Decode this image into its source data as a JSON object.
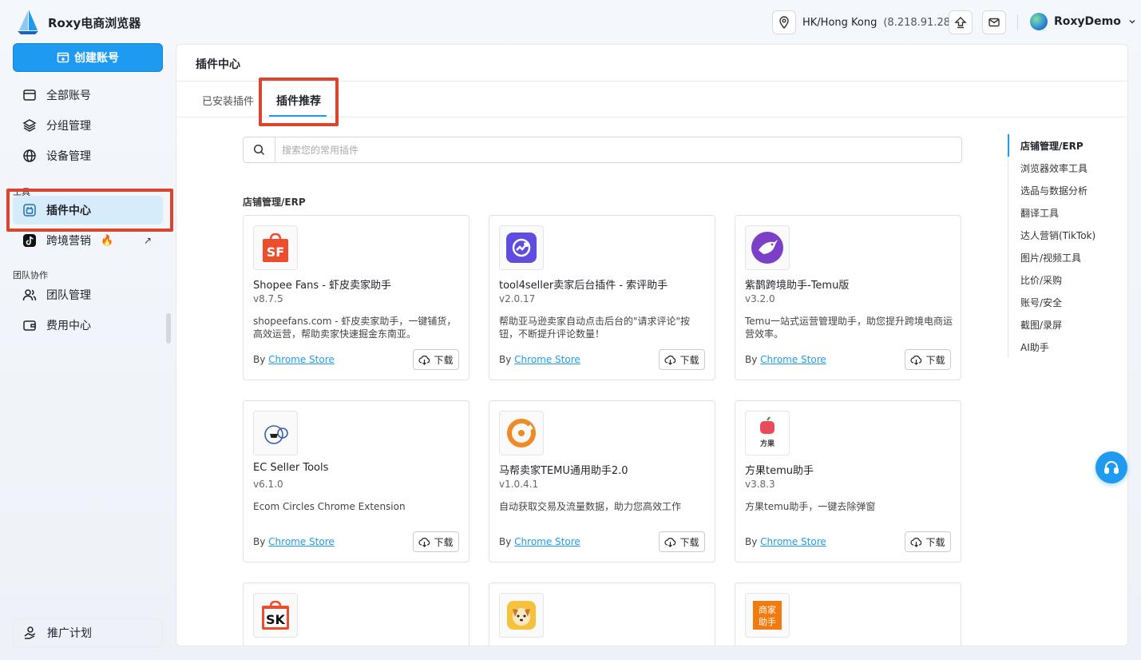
{
  "app": {
    "title": "Roxy电商浏览器"
  },
  "sidebar": {
    "create_label": "创建账号",
    "items": [
      {
        "label": "全部账号"
      },
      {
        "label": "分组管理"
      },
      {
        "label": "设备管理"
      }
    ],
    "tools_section": "工具",
    "tool_items": [
      {
        "label": "插件中心"
      },
      {
        "label": "跨境营销"
      }
    ],
    "team_section": "团队协作",
    "team_items": [
      {
        "label": "团队管理"
      },
      {
        "label": "费用中心"
      }
    ],
    "promo_label": "推广计划"
  },
  "topbar": {
    "location": "HK/Hong Kong",
    "ip": "(8.218.91.28)",
    "username": "RoxyDemo"
  },
  "main": {
    "title": "插件中心",
    "tabs": [
      {
        "label": "已安装插件"
      },
      {
        "label": "插件推荐"
      }
    ],
    "search_placeholder": "搜索您的常用插件",
    "section_title": "店铺管理/ERP",
    "by_label": "By",
    "download_label": "下载",
    "cards": [
      {
        "name": "Shopee Fans - 虾皮卖家助手",
        "version": "v8.7.5",
        "desc": "shopeefans.com - 虾皮卖家助手，一键铺货，高效运营，帮助卖家快速掘金东南亚。",
        "source": "Chrome Store"
      },
      {
        "name": "tool4seller卖家后台插件 - 索评助手",
        "version": "v2.0.17",
        "desc": "帮助亚马逊卖家自动点击后台的\"请求评论\"按钮，不断提升评论数量！",
        "source": "Chrome Store"
      },
      {
        "name": "紫鹊跨境助手-Temu版",
        "version": "v3.2.0",
        "desc": "Temu一站式运营管理助手，助您提升跨境电商运营效率。",
        "source": "Chrome Store"
      },
      {
        "name": "EC Seller Tools",
        "version": "v6.1.0",
        "desc": "Ecom Circles Chrome Extension",
        "source": "Chrome Store"
      },
      {
        "name": "马帮卖家TEMU通用助手2.0",
        "version": "v1.0.4.1",
        "desc": "自动获取交易及流量数据，助力您高效工作",
        "source": "Chrome Store"
      },
      {
        "name": "方果temu助手",
        "version": "v3.8.3",
        "desc": "方果temu助手，一键去除弹窗",
        "source": "Chrome Store"
      }
    ],
    "icon_texts": {
      "shopee": "SF",
      "sk": "SK",
      "fangguo": "方果",
      "merchant": "商家助手"
    }
  },
  "anchor_nav": [
    "店铺管理/ERP",
    "浏览器效率工具",
    "选品与数据分析",
    "翻译工具",
    "达人营销(TikTok)",
    "图片/视频工具",
    "比价/采购",
    "账号/安全",
    "截图/录屏",
    "AI助手"
  ],
  "colors": {
    "accent": "#1e9bf0",
    "highlight": "#d9452f"
  }
}
